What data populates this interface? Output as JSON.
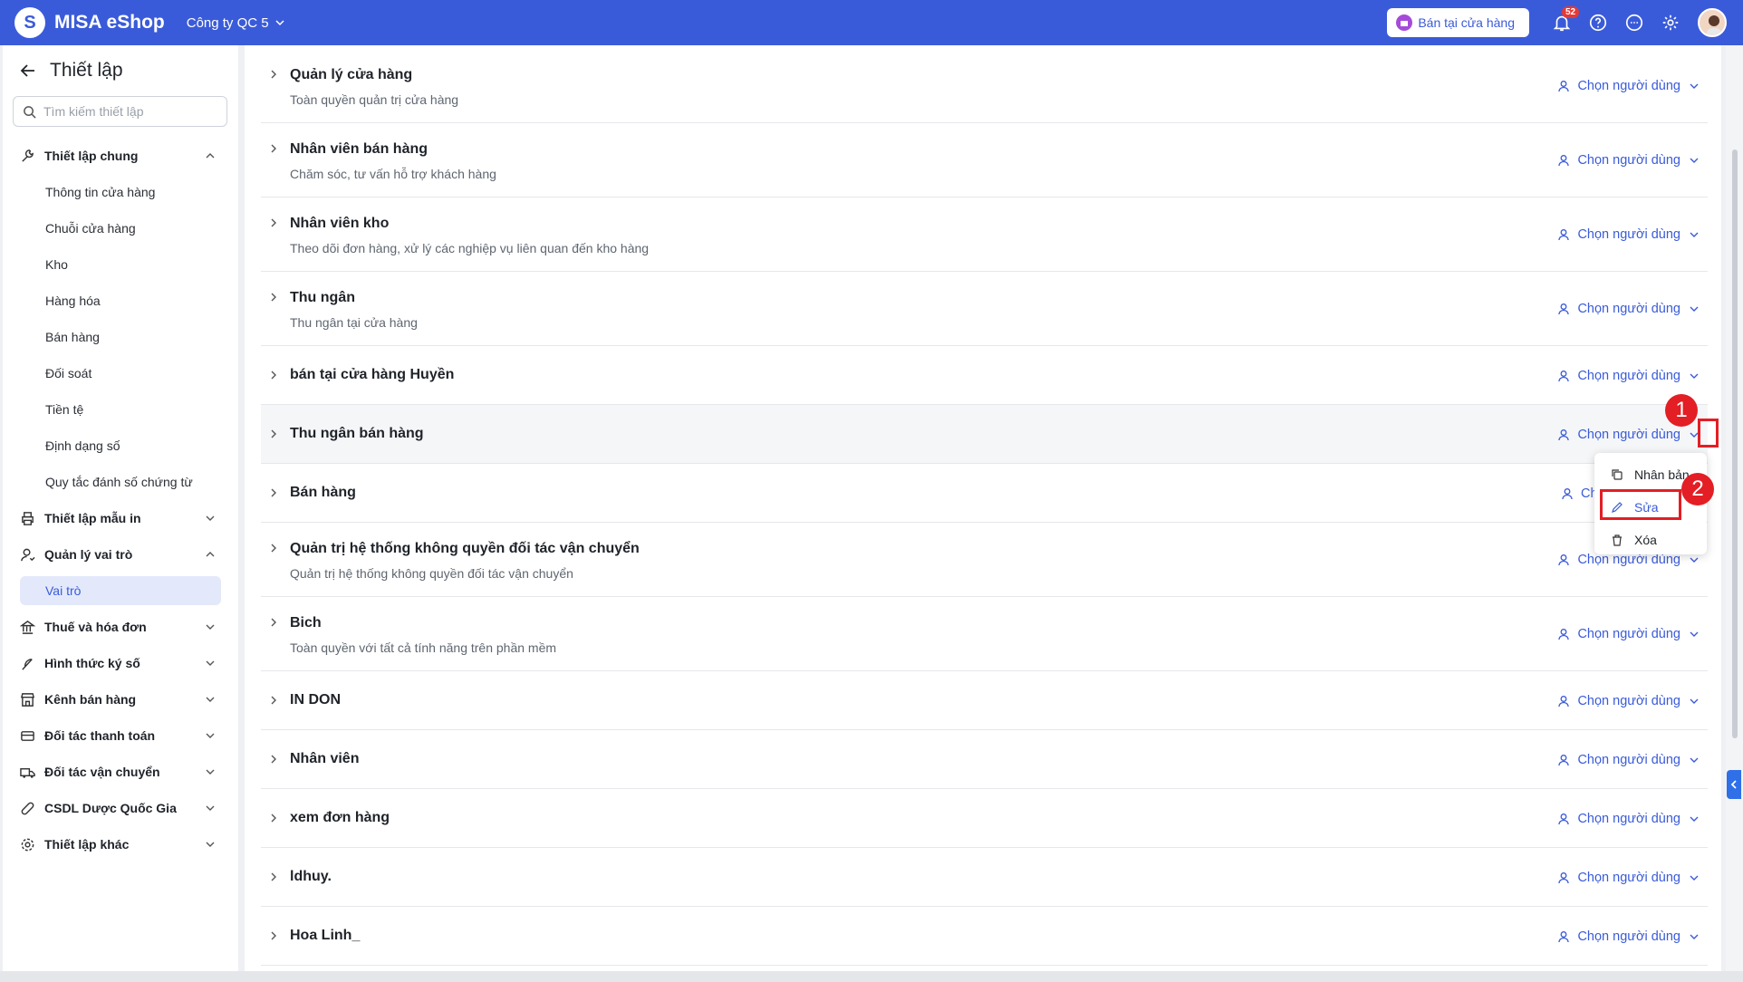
{
  "app": {
    "brand": "MISA eShop",
    "company": "Công ty QC 5",
    "store_button": "Bán tại cửa hàng",
    "notification_count": "52",
    "accent_color": "#3a5bd9"
  },
  "sidebar": {
    "title": "Thiết lập",
    "search_placeholder": "Tìm kiếm thiết lập",
    "groups": [
      {
        "label": "Thiết lập chung",
        "icon": "wrench-icon",
        "expanded": true,
        "items": [
          "Thông tin cửa hàng",
          "Chuỗi cửa hàng",
          "Kho",
          "Hàng hóa",
          "Bán hàng",
          "Đối soát",
          "Tiền tệ",
          "Định dạng số",
          "Quy tắc đánh số chứng từ"
        ]
      },
      {
        "label": "Thiết lập mẫu in",
        "icon": "printer-icon",
        "expanded": false
      },
      {
        "label": "Quản lý vai trò",
        "icon": "user-role-icon",
        "expanded": true,
        "items": [
          "Vai trò"
        ]
      },
      {
        "label": "Thuế và hóa đơn",
        "icon": "bank-icon",
        "expanded": false
      },
      {
        "label": "Hình thức ký số",
        "icon": "feather-icon",
        "expanded": false
      },
      {
        "label": "Kênh bán hàng",
        "icon": "store-icon",
        "expanded": false
      },
      {
        "label": "Đối tác thanh toán",
        "icon": "card-icon",
        "expanded": false
      },
      {
        "label": "Đối tác vận chuyển",
        "icon": "truck-icon",
        "expanded": false
      },
      {
        "label": "CSDL Dược Quốc Gia",
        "icon": "pill-icon",
        "expanded": false
      },
      {
        "label": "Thiết lập khác",
        "icon": "gear-icon",
        "expanded": false
      }
    ],
    "active_item": "Vai trò"
  },
  "roles": {
    "picker_label": "Chọn người dùng",
    "items": [
      {
        "name": "Quản lý cửa hàng",
        "desc": "Toàn quyền quản trị cửa hàng"
      },
      {
        "name": "Nhân viên bán hàng",
        "desc": "Chăm sóc, tư vấn hỗ trợ khách hàng"
      },
      {
        "name": "Nhân viên kho",
        "desc": "Theo dõi đơn hàng, xử lý các nghiệp vụ liên quan đến kho hàng"
      },
      {
        "name": "Thu ngân",
        "desc": "Thu ngân tại cửa hàng"
      },
      {
        "name": "bán tại cửa hàng Huyền",
        "desc": ""
      },
      {
        "name": "Thu ngân bán hàng",
        "desc": ""
      },
      {
        "name": "Bán hàng",
        "desc": ""
      },
      {
        "name": "Quản trị hệ thống không quyền đối tác vận chuyển",
        "desc": "Quản trị hệ thống không quyền đối tác vận chuyển"
      },
      {
        "name": "Bich",
        "desc": "Toàn quyền với tất cả tính năng trên phần mềm"
      },
      {
        "name": "IN DON",
        "desc": ""
      },
      {
        "name": "Nhân viên",
        "desc": ""
      },
      {
        "name": "xem đơn hàng",
        "desc": ""
      },
      {
        "name": "ldhuy.",
        "desc": ""
      },
      {
        "name": "Hoa Linh_",
        "desc": ""
      }
    ]
  },
  "context_menu": {
    "items": [
      {
        "label": "Nhân bản",
        "icon": "copy-icon"
      },
      {
        "label": "Sửa",
        "icon": "edit-icon"
      },
      {
        "label": "Xóa",
        "icon": "trash-icon"
      }
    ]
  },
  "annotations": {
    "step1": "1",
    "step2": "2",
    "color": "#e31e24"
  }
}
